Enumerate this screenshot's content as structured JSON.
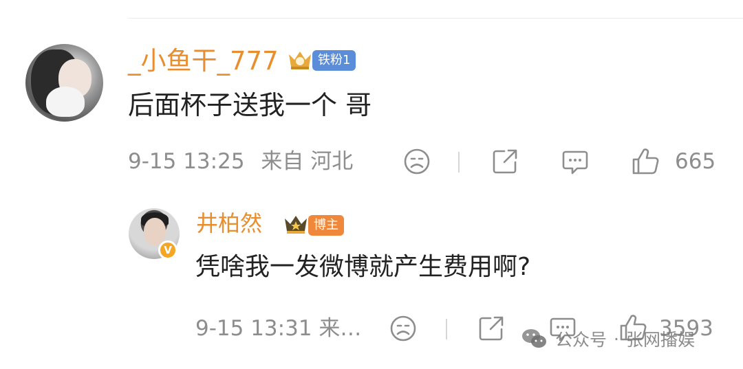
{
  "comment": {
    "username": "_小鱼干_777",
    "badge": "铁粉1",
    "text": "后面杯子送我一个 哥",
    "time": "9-15 13:25",
    "location": "来自 河北",
    "likes": "665"
  },
  "reply": {
    "username": "井柏然",
    "badge": "博主",
    "text": "凭啥我一发微博就产生费用啊?",
    "time_location": "9-15 13:31  来…",
    "likes": "3593"
  },
  "watermark": {
    "label": "公众号",
    "dot": "·",
    "name": "张网播娱"
  },
  "icons": [
    "avatar",
    "crown-icon",
    "verified-icon",
    "dislike-face-icon",
    "share-icon",
    "comment-icon",
    "thumbs-up-icon",
    "wechat-icon"
  ],
  "colors": {
    "username": "#e98e2e",
    "fan_badge": "#5b8dd8",
    "owner_badge": "#f0883b",
    "meta": "#8d8d8d",
    "verified": "#f5a623"
  }
}
